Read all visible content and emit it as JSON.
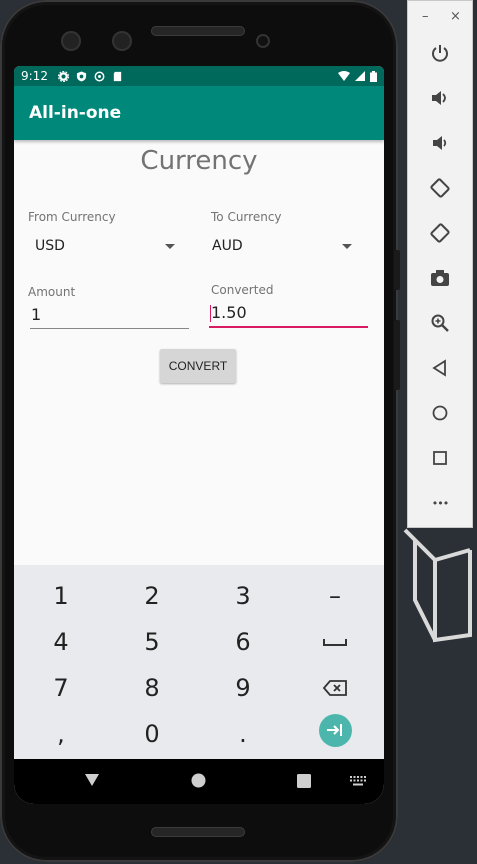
{
  "status_bar": {
    "time": "9:12"
  },
  "app_bar": {
    "title": "All-in-one"
  },
  "screen": {
    "title": "Currency",
    "from_currency": {
      "label": "From Currency",
      "value": "USD"
    },
    "to_currency": {
      "label": "To Currency",
      "value": "AUD"
    },
    "amount": {
      "label": "Amount",
      "value": "1"
    },
    "converted": {
      "label": "Converted",
      "value": "1.50"
    },
    "convert_button": "CONVERT"
  },
  "keyboard": {
    "rows": [
      [
        "1",
        "2",
        "3",
        "–"
      ],
      [
        "4",
        "5",
        "6",
        "␣"
      ],
      [
        "7",
        "8",
        "9",
        "backspace"
      ],
      [
        ",",
        "0",
        ".",
        "enter"
      ]
    ]
  },
  "emulator_controls": {
    "window": [
      "–",
      "×"
    ],
    "buttons": [
      "power-icon",
      "volume-up-icon",
      "volume-down-icon",
      "rotate-left-icon",
      "rotate-right-icon",
      "camera-icon",
      "zoom-icon",
      "back-icon",
      "home-icon",
      "overview-icon",
      "more-icon"
    ],
    "more_label": "•••"
  },
  "colors": {
    "status_bar": "#00695c",
    "app_bar": "#00897b",
    "accent": "#d81b60",
    "keyboard_enter": "#4db6ac"
  }
}
